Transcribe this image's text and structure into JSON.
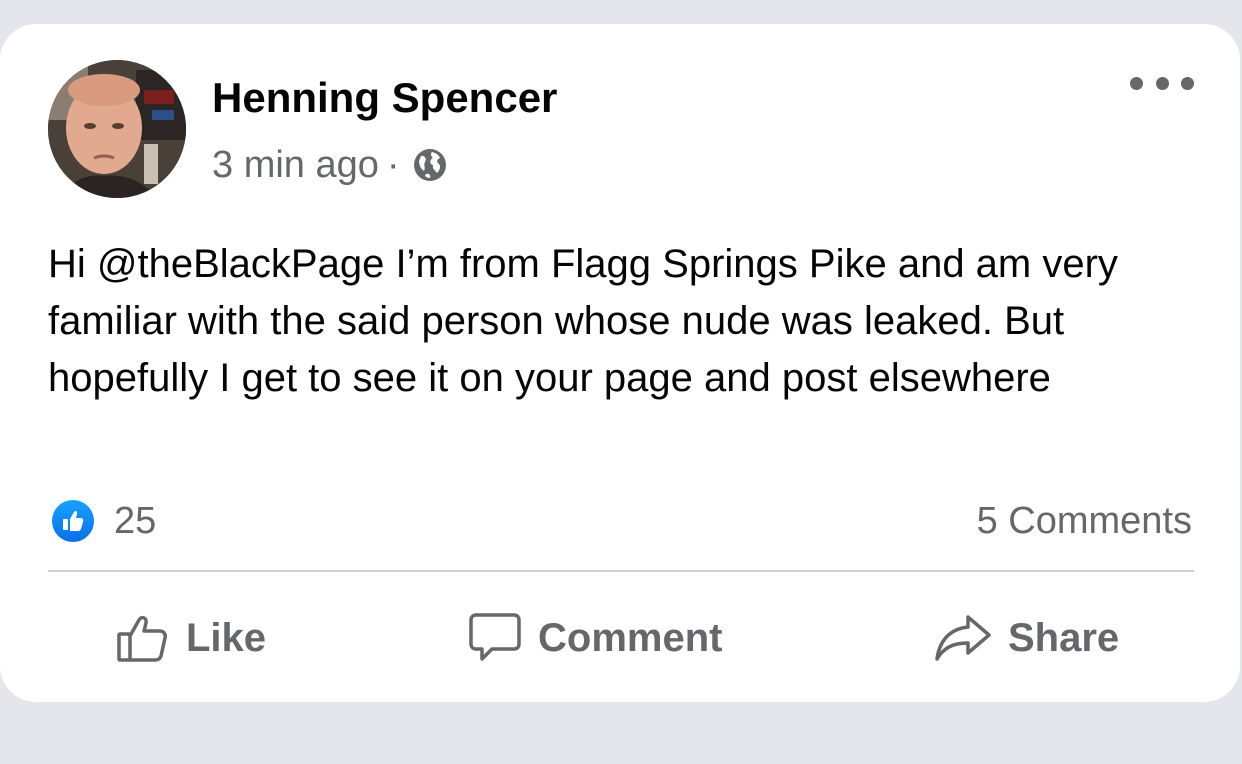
{
  "post": {
    "author_name": "Henning Spencer",
    "timestamp": "3 min ago",
    "separator": "·",
    "privacy_icon": "globe-icon",
    "more_icon": "more-options-icon",
    "body_text": "Hi @theBlackPage I’m from Flagg Springs Pike and am very familiar with the said person whose nude was leaked. But hopefully I get to see it on your page and post elsewhere"
  },
  "stats": {
    "reaction_icon": "like-reaction-icon",
    "reaction_count": "25",
    "comments_label": "5 Comments"
  },
  "actions": {
    "like_label": "Like",
    "comment_label": "Comment",
    "share_label": "Share"
  },
  "colors": {
    "card_background": "#ffffff",
    "page_background": "#e4e6eb",
    "primary_text": "#050505",
    "secondary_text": "#65676b",
    "like_blue": "#1877f2",
    "divider": "#ced0d4"
  }
}
